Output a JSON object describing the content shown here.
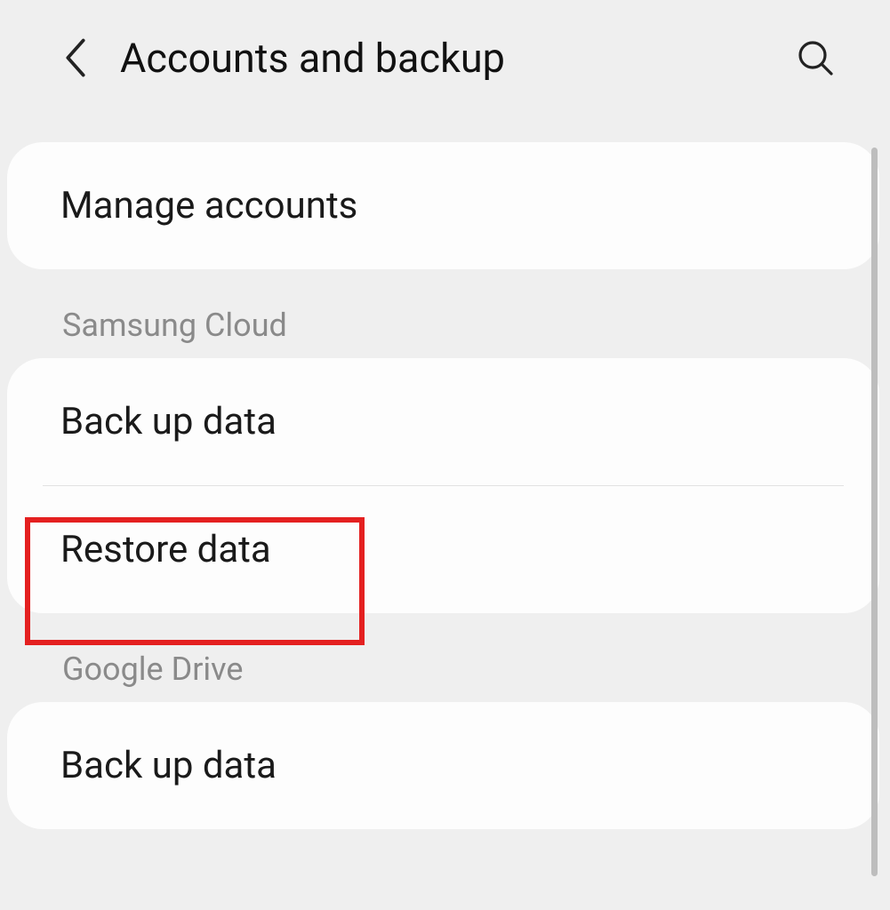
{
  "header": {
    "title": "Accounts and backup"
  },
  "sections": {
    "general": {
      "items": [
        {
          "label": "Manage accounts"
        }
      ]
    },
    "samsung_cloud": {
      "title": "Samsung Cloud",
      "items": [
        {
          "label": "Back up data"
        },
        {
          "label": "Restore data"
        }
      ]
    },
    "google_drive": {
      "title": "Google Drive",
      "items": [
        {
          "label": "Back up data"
        }
      ]
    }
  },
  "highlight": {
    "target": "restore-data"
  }
}
